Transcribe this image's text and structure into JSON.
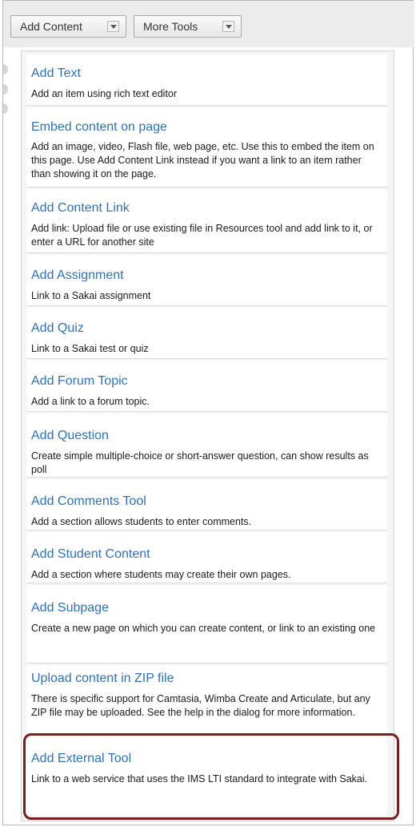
{
  "toolbar": {
    "add_content_label": "Add Content",
    "more_tools_label": "More Tools"
  },
  "menu": {
    "items": [
      {
        "title": "Add Text",
        "description": "Add an item using rich text editor"
      },
      {
        "title": "Embed content on page",
        "description": "Add an image, video, Flash file, web page, etc. Use this to embed the item on this page. Use Add Content Link instead if you want a link to an item rather than showing it on the page."
      },
      {
        "title": "Add Content Link",
        "description": "Add link: Upload file or use existing file in Resources tool and add link to it, or enter a URL for another site"
      },
      {
        "title": "Add Assignment",
        "description": "Link to a Sakai assignment"
      },
      {
        "title": "Add Quiz",
        "description": "Link to a Sakai test or quiz"
      },
      {
        "title": "Add Forum Topic",
        "description": "Add a link to a forum topic."
      },
      {
        "title": "Add Question",
        "description": "Create simple multiple-choice or short-answer question, can show results as poll"
      },
      {
        "title": "Add Comments Tool",
        "description": "Add a section allows students to enter comments."
      },
      {
        "title": "Add Student Content",
        "description": "Add a section where students may create their own pages."
      },
      {
        "title": "Add Subpage",
        "description": "Create a new page on which you can create content, or link to an existing one"
      },
      {
        "title": "Upload content in ZIP file",
        "description": "There is specific support for Camtasia, Wimba Create and Articulate, but any ZIP file may be uploaded. See the help in the dialog for more information."
      },
      {
        "title": "Add External Tool",
        "description": "Link to a web service that uses the IMS LTI standard to integrate with Sakai."
      }
    ]
  },
  "colors": {
    "link": "#2f71b9",
    "highlight_border": "#7a1f1f"
  },
  "icons": {
    "dropdown": "chevron-down-icon"
  }
}
